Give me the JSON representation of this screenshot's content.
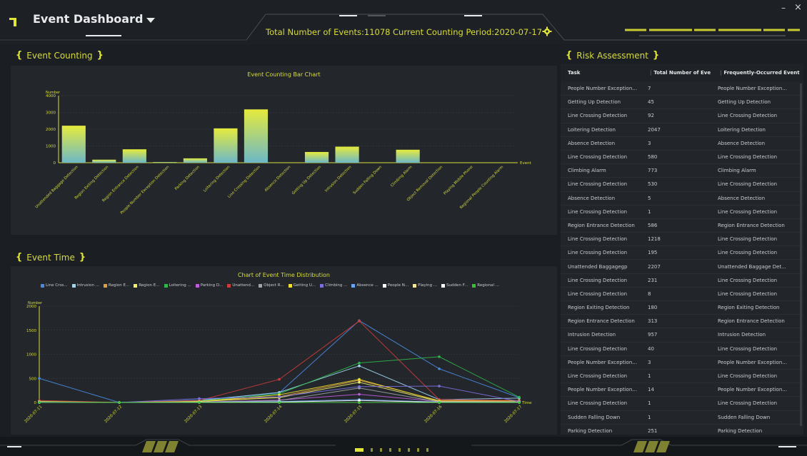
{
  "header": {
    "title": "Event Dashboard",
    "total_events_label": "Total Number of Events:11078",
    "period_label": "Current Counting Period:2020-07-17",
    "minimize_glyph": "–",
    "close_glyph": "×"
  },
  "sections": {
    "event_counting": "Event Counting",
    "event_time": "Event Time",
    "risk_assessment": "Risk Assessment"
  },
  "colors": {
    "accent": "#e3e63a",
    "background": "#1b1e22",
    "panel": "#23272c"
  },
  "bar_chart": {
    "chart_data": {
      "type": "bar",
      "title": "Event Counting Bar Chart",
      "ylabel": "Number",
      "xlabel": "Event",
      "ylim": [
        0,
        4000
      ],
      "yticks": [
        0,
        1000,
        2000,
        3000,
        4000
      ],
      "categories": [
        "Unattended Baggage Detection",
        "Region Exiting Detection",
        "Region Entrance Detection",
        "People Number Exception Detection",
        "Parking Detection",
        "Loitering Detection",
        "Line Crossing Detection",
        "Absence Detection",
        "Getting Up Detection",
        "Intrusion Detection",
        "Sudden Falling Down",
        "Climbing Alarm",
        "Object Removal Detection",
        "Playing Mobile Phone",
        "Regional People Counting Alarm"
      ],
      "values": [
        2207,
        180,
        800,
        40,
        260,
        2047,
        3180,
        10,
        640,
        957,
        0,
        773,
        0,
        0,
        0
      ]
    }
  },
  "line_chart": {
    "chart_data": {
      "type": "line",
      "title": "Chart of Event Time Distribution",
      "ylabel": "Number",
      "xlabel": "Time",
      "ylim": [
        0,
        2000
      ],
      "yticks": [
        0,
        500,
        1000,
        1500,
        2000
      ],
      "x": [
        "2020-07-11",
        "2020-07-12",
        "2020-07-13",
        "2020-07-14",
        "2020-07-15",
        "2020-07-16",
        "2020-07-17"
      ],
      "series": [
        {
          "name": "Line Cros...",
          "color": "#4a8ae0",
          "values": [
            500,
            0,
            50,
            200,
            1700,
            700,
            100
          ]
        },
        {
          "name": "Intrusion ...",
          "color": "#9fd6ef",
          "values": [
            0,
            0,
            40,
            210,
            760,
            60,
            90
          ]
        },
        {
          "name": "Region E...",
          "color": "#e0a040",
          "values": [
            20,
            0,
            30,
            120,
            460,
            40,
            40
          ]
        },
        {
          "name": "Region E...",
          "color": "#f3f06a",
          "values": [
            10,
            0,
            20,
            100,
            420,
            20,
            30
          ]
        },
        {
          "name": "Loitering ...",
          "color": "#2fb84a",
          "values": [
            30,
            0,
            30,
            180,
            820,
            950,
            110
          ]
        },
        {
          "name": "Parking D...",
          "color": "#c05ce0",
          "values": [
            10,
            0,
            10,
            50,
            170,
            20,
            10
          ]
        },
        {
          "name": "Unattend...",
          "color": "#d03a3a",
          "values": [
            40,
            0,
            40,
            480,
            1690,
            60,
            40
          ]
        },
        {
          "name": "Object R...",
          "color": "#a0a4a8",
          "values": [
            5,
            0,
            5,
            40,
            300,
            10,
            10
          ]
        },
        {
          "name": "Getting U...",
          "color": "#f0e030",
          "values": [
            20,
            0,
            20,
            160,
            480,
            30,
            30
          ]
        },
        {
          "name": "Climbing ...",
          "color": "#7b6fe0",
          "values": [
            10,
            0,
            80,
            120,
            330,
            340,
            20
          ]
        },
        {
          "name": "Absence ...",
          "color": "#6aa6f0",
          "values": [
            0,
            0,
            5,
            20,
            60,
            10,
            5
          ]
        },
        {
          "name": "People N...",
          "color": "#ffffff",
          "values": [
            0,
            0,
            5,
            10,
            40,
            5,
            5
          ]
        },
        {
          "name": "Playing ...",
          "color": "#f5e89a",
          "values": [
            0,
            0,
            0,
            0,
            0,
            0,
            0
          ]
        },
        {
          "name": "Sudden F...",
          "color": "#ffffff",
          "values": [
            0,
            0,
            0,
            0,
            0,
            0,
            0
          ]
        },
        {
          "name": "Regional ...",
          "color": "#34c234",
          "values": [
            0,
            0,
            0,
            0,
            0,
            0,
            0
          ]
        }
      ]
    }
  },
  "risk_table": {
    "columns": [
      "Task",
      "Total Number of Events",
      "Frequently-Occurred Event"
    ],
    "rows": [
      [
        "People Number Exception...",
        "7",
        "People Number Exception..."
      ],
      [
        "Getting Up Detection",
        "45",
        "Getting Up Detection"
      ],
      [
        "Line Crossing Detection",
        "92",
        "Line Crossing Detection"
      ],
      [
        "Loitering Detection",
        "2047",
        "Loitering Detection"
      ],
      [
        "Absence Detection",
        "3",
        "Absence Detection"
      ],
      [
        "Line Crossing Detection",
        "580",
        "Line Crossing Detection"
      ],
      [
        "Climbing Alarm",
        "773",
        "Climbing Alarm"
      ],
      [
        "Line Crossing Detection",
        "530",
        "Line Crossing Detection"
      ],
      [
        "Absence Detection",
        "5",
        "Absence Detection"
      ],
      [
        "Line Crossing Detection",
        "1",
        "Line Crossing Detection"
      ],
      [
        "Region Entrance Detection",
        "586",
        "Region Entrance Detection"
      ],
      [
        "Line Crossing Detection",
        "1218",
        "Line Crossing Detection"
      ],
      [
        "Line Crossing Detection",
        "195",
        "Line Crossing Detection"
      ],
      [
        "Unattended Baggagegp",
        "2207",
        "Unattended Baggage Det..."
      ],
      [
        "Line Crossing Detection",
        "231",
        "Line Crossing Detection"
      ],
      [
        "Line Crossing Detection",
        "8",
        "Line Crossing Detection"
      ],
      [
        "Region Exiting Detection",
        "180",
        "Region Exiting Detection"
      ],
      [
        "Region Entrance Detection",
        "313",
        "Region Entrance Detection"
      ],
      [
        "Intrusion Detection",
        "957",
        "Intrusion Detection"
      ],
      [
        "Line Crossing Detection",
        "40",
        "Line Crossing Detection"
      ],
      [
        "People Number Exception...",
        "3",
        "People Number Exception..."
      ],
      [
        "Line Crossing Detection",
        "1",
        "Line Crossing Detection"
      ],
      [
        "People Number Exception...",
        "14",
        "People Number Exception..."
      ],
      [
        "Line Crossing Detection",
        "1",
        "Line Crossing Detection"
      ],
      [
        "Sudden Falling Down",
        "1",
        "Sudden Falling Down"
      ],
      [
        "Parking Detection",
        "251",
        "Parking Detection"
      ]
    ]
  },
  "pagination": {
    "count": 8,
    "active": 0
  }
}
